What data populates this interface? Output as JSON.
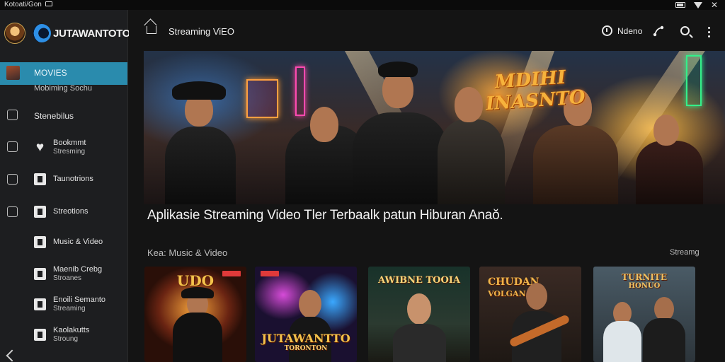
{
  "status_bar": {
    "left_text": "Kotoati/Gon",
    "icons": [
      "cast-icon",
      "battery-icon",
      "wifi-icon",
      "close-icon"
    ]
  },
  "sidebar": {
    "brand_name": "JUTAWANTOTO",
    "active_item": {
      "label": "MOVIES",
      "sublabel": "Mobiming Sochu"
    },
    "items": [
      {
        "label": "Stenebilus",
        "icon": "folder-icon"
      },
      {
        "label": "Bookmmt",
        "sublabel": "Stresming",
        "icon": "heart-icon"
      },
      {
        "label": "Taunotrions",
        "icon": "camera-icon"
      },
      {
        "label": "Streotions",
        "icon": "camera-icon"
      },
      {
        "label": "Music & Video",
        "icon": "music-icon"
      },
      {
        "label": "Maenib Crebg",
        "sublabel": "Stroanes",
        "icon": "tv-icon"
      },
      {
        "label": "Enoili Semanto",
        "sublabel": "Streaming",
        "icon": "tv-icon"
      },
      {
        "label": "Kaolakutts",
        "sublabel": "Stroung",
        "icon": "tv-icon"
      }
    ]
  },
  "topbar": {
    "title": "Streaming ViEO",
    "video_label": "Ndeno"
  },
  "hero": {
    "logo_line1": "MDIHI",
    "logo_line2": "INASNTO"
  },
  "headline": "Aplikasie Streaming Video Tler Terbaalk patun Hiburan Anaŏ.",
  "section": {
    "label": "Kea: Music & Video",
    "more": "Streamg"
  },
  "cards": [
    {
      "title": "UDO"
    },
    {
      "title": "JUTAWANTTO",
      "subtitle": "TORONTON"
    },
    {
      "title": "AWIBNE TOOIA"
    },
    {
      "title": "CHUDAN",
      "subtitle": "VOLGAN"
    },
    {
      "title": "TURNITE",
      "subtitle": "HONUO"
    }
  ],
  "colors": {
    "accent": "#2a8bad",
    "background": "#141414",
    "sidebar": "#1d1e20"
  }
}
